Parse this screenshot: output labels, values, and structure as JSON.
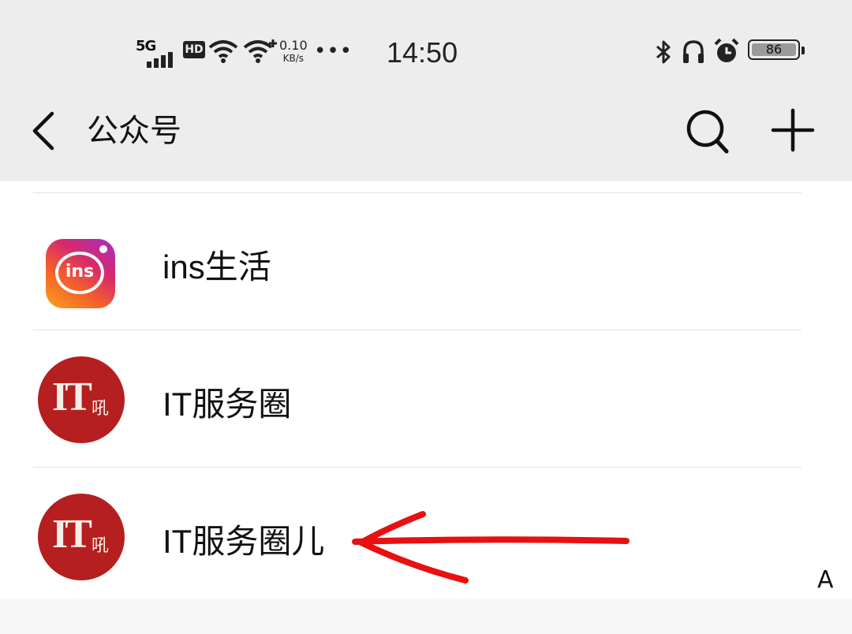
{
  "status_bar": {
    "network": "5G",
    "hd": "HD",
    "speed_value": "0.10",
    "speed_unit": "KB/s",
    "more": "•••",
    "time": "14:50",
    "battery": "86"
  },
  "nav": {
    "title": "公众号"
  },
  "accounts": [
    {
      "name": "ins生活",
      "avatar_text": "ins"
    },
    {
      "name": "IT服务圈",
      "avatar_big": "IT",
      "avatar_small": "吼"
    },
    {
      "name": "IT服务圈儿",
      "avatar_big": "IT",
      "avatar_small": "吼"
    }
  ],
  "index_letter": "A",
  "colors": {
    "header_bg": "#ededed",
    "it_avatar": "#b51f1f",
    "annotation_arrow": "#e81010"
  }
}
